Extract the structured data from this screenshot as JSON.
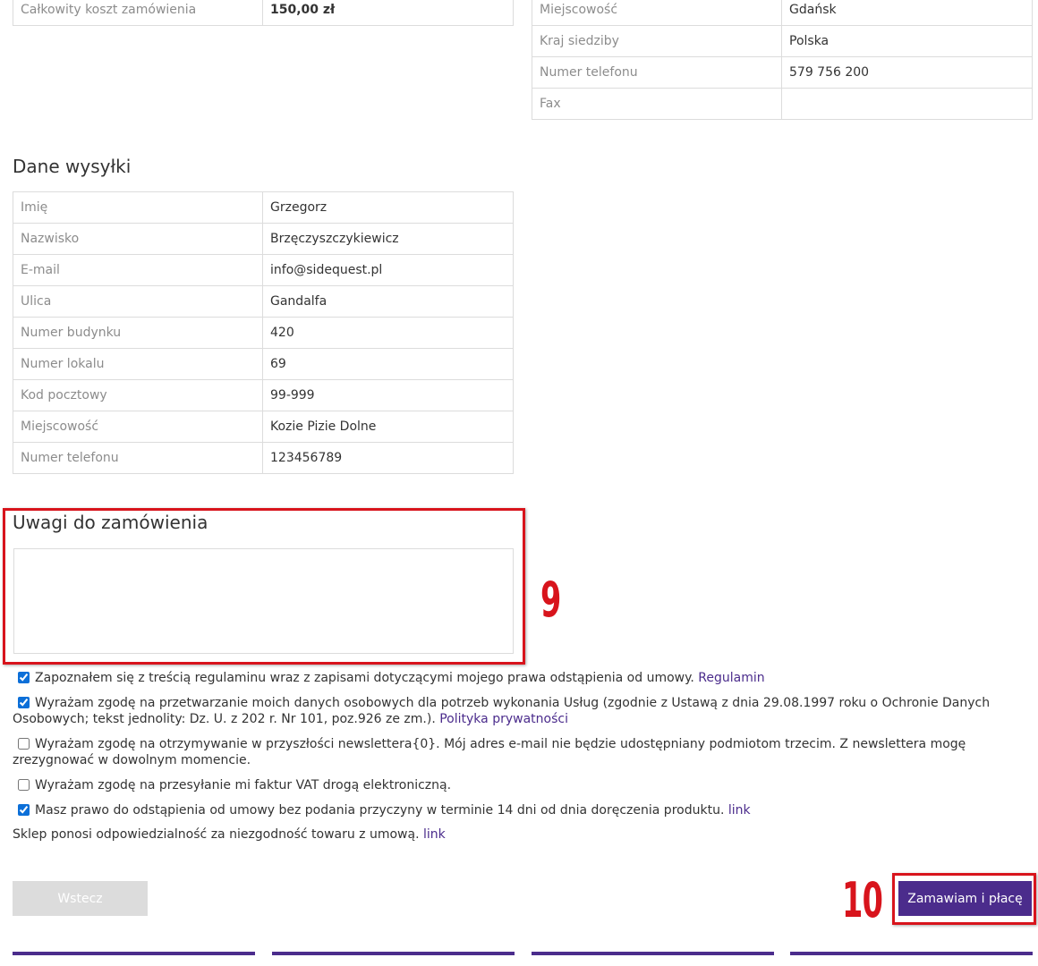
{
  "order_summary": {
    "rows": [
      {
        "label": "Całkowity koszt zamówienia",
        "value": "150,00 zł"
      }
    ]
  },
  "company": {
    "rows": [
      {
        "label": "Miejscowość",
        "value": "Gdańsk"
      },
      {
        "label": "Kraj siedziby",
        "value": "Polska"
      },
      {
        "label": "Numer telefonu",
        "value": "579 756 200"
      },
      {
        "label": "Fax",
        "value": ""
      }
    ]
  },
  "shipping": {
    "title": "Dane wysyłki",
    "rows": [
      {
        "label": "Imię",
        "value": "Grzegorz"
      },
      {
        "label": "Nazwisko",
        "value": "Brzęczyszczykiewicz"
      },
      {
        "label": "E-mail",
        "value": "info@sidequest.pl"
      },
      {
        "label": "Ulica",
        "value": "Gandalfa"
      },
      {
        "label": "Numer budynku",
        "value": "420"
      },
      {
        "label": "Numer lokalu",
        "value": "69"
      },
      {
        "label": "Kod pocztowy",
        "value": "99-999"
      },
      {
        "label": "Miejscowość",
        "value": "Kozie Pizie Dolne"
      },
      {
        "label": "Numer telefonu",
        "value": "123456789"
      }
    ]
  },
  "notes": {
    "title": "Uwagi do zamówienia",
    "value": ""
  },
  "annotations": {
    "step_notes": "9",
    "step_submit": "10",
    "color": "#d8141c"
  },
  "consents": [
    {
      "checked": true,
      "text": "Zapoznałem się z treścią regulaminu wraz z zapisami dotyczącymi mojego prawa odstąpienia od umowy. ",
      "link": "Regulamin"
    },
    {
      "checked": true,
      "text": "Wyrażam zgodę na przetwarzanie moich danych osobowych dla potrzeb wykonania Usług (zgodnie z Ustawą z dnia 29.08.1997 roku o Ochronie Danych Osobowych; tekst jednolity: Dz. U. z 202 r. Nr 101, poz.926 ze zm.). ",
      "link": "Polityka prywatności"
    },
    {
      "checked": false,
      "text": "Wyrażam zgodę na otrzymywanie w przyszłości newslettera{0}. Mój adres e-mail nie będzie udostępniany podmiotom trzecim. Z newslettera mogę zrezygnować w dowolnym momencie.",
      "link": ""
    },
    {
      "checked": false,
      "text": "Wyrażam zgodę na przesyłanie mi faktur VAT drogą elektroniczną.",
      "link": ""
    },
    {
      "checked": true,
      "text": "Masz prawo do odstąpienia od umowy bez podania przyczyny w terminie 14 dni od dnia doręczenia produktu. ",
      "link": "link"
    }
  ],
  "liability_note": {
    "text": "Sklep ponosi odpowiedzialność za niezgodność towaru z umową. ",
    "link": "link"
  },
  "buttons": {
    "back_label": "Wstecz",
    "submit_label": "Zamawiam i płacę"
  },
  "colors": {
    "brand": "#4b2c8c",
    "disabled": "#dcdcdc",
    "checkbox": "#0c6fd8"
  }
}
